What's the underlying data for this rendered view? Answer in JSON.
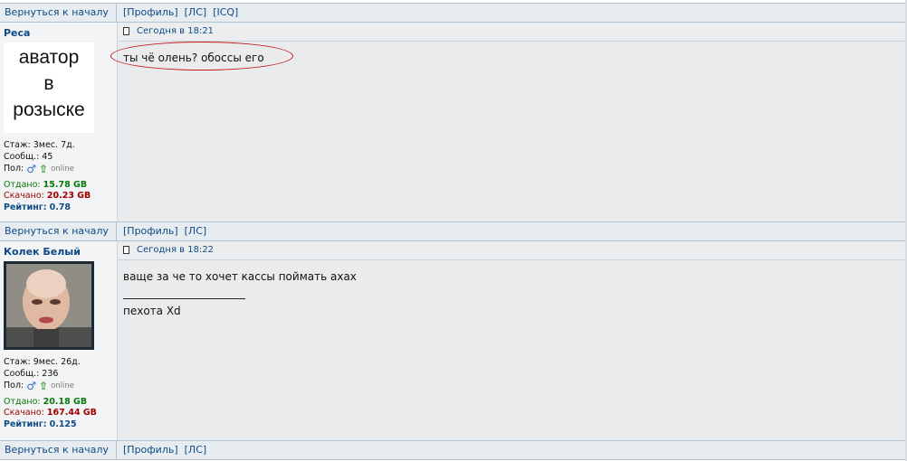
{
  "nav": {
    "back_to_top": "Вернуться к началу",
    "profile": "[Профиль]",
    "pm": "[ЛС]",
    "icq": "[ICQ]"
  },
  "posts": [
    {
      "username": "Реса",
      "avatar_text": [
        "аватор",
        "в",
        "розыске"
      ],
      "experience": "Стаж: 3мес. 7д.",
      "messages": "Сообщ.: 45",
      "gender_label": "Пол:",
      "online": "online",
      "uploaded_label": "Отдано:",
      "uploaded_value": "15.78 GB",
      "downloaded_label": "Скачано:",
      "downloaded_value": "20.23 GB",
      "rating_label": "Рейтинг:",
      "rating_value": "0.78",
      "date": "Сегодня в 18:21",
      "text": "ты чё олень? обоссы его"
    },
    {
      "username": "Колек Белый",
      "experience": "Стаж: 9мес. 26д.",
      "messages": "Сообщ.: 236",
      "gender_label": "Пол:",
      "online": "online",
      "uploaded_label": "Отдано:",
      "uploaded_value": "20.18 GB",
      "downloaded_label": "Скачано:",
      "downloaded_value": "167.44 GB",
      "rating_label": "Рейтинг:",
      "rating_value": "0.125",
      "date": "Сегодня в 18:22",
      "text": "ваще за че то хочет кассы поймать ахах",
      "signature": "пехота Xd"
    }
  ],
  "icons": {
    "male": "male-icon",
    "online": "online-arrow-icon",
    "post": "post-icon"
  },
  "colors": {
    "link": "#0f4a85",
    "uploaded": "#0a7a0a",
    "downloaded": "#a00000",
    "highlight": "#c8171b"
  }
}
